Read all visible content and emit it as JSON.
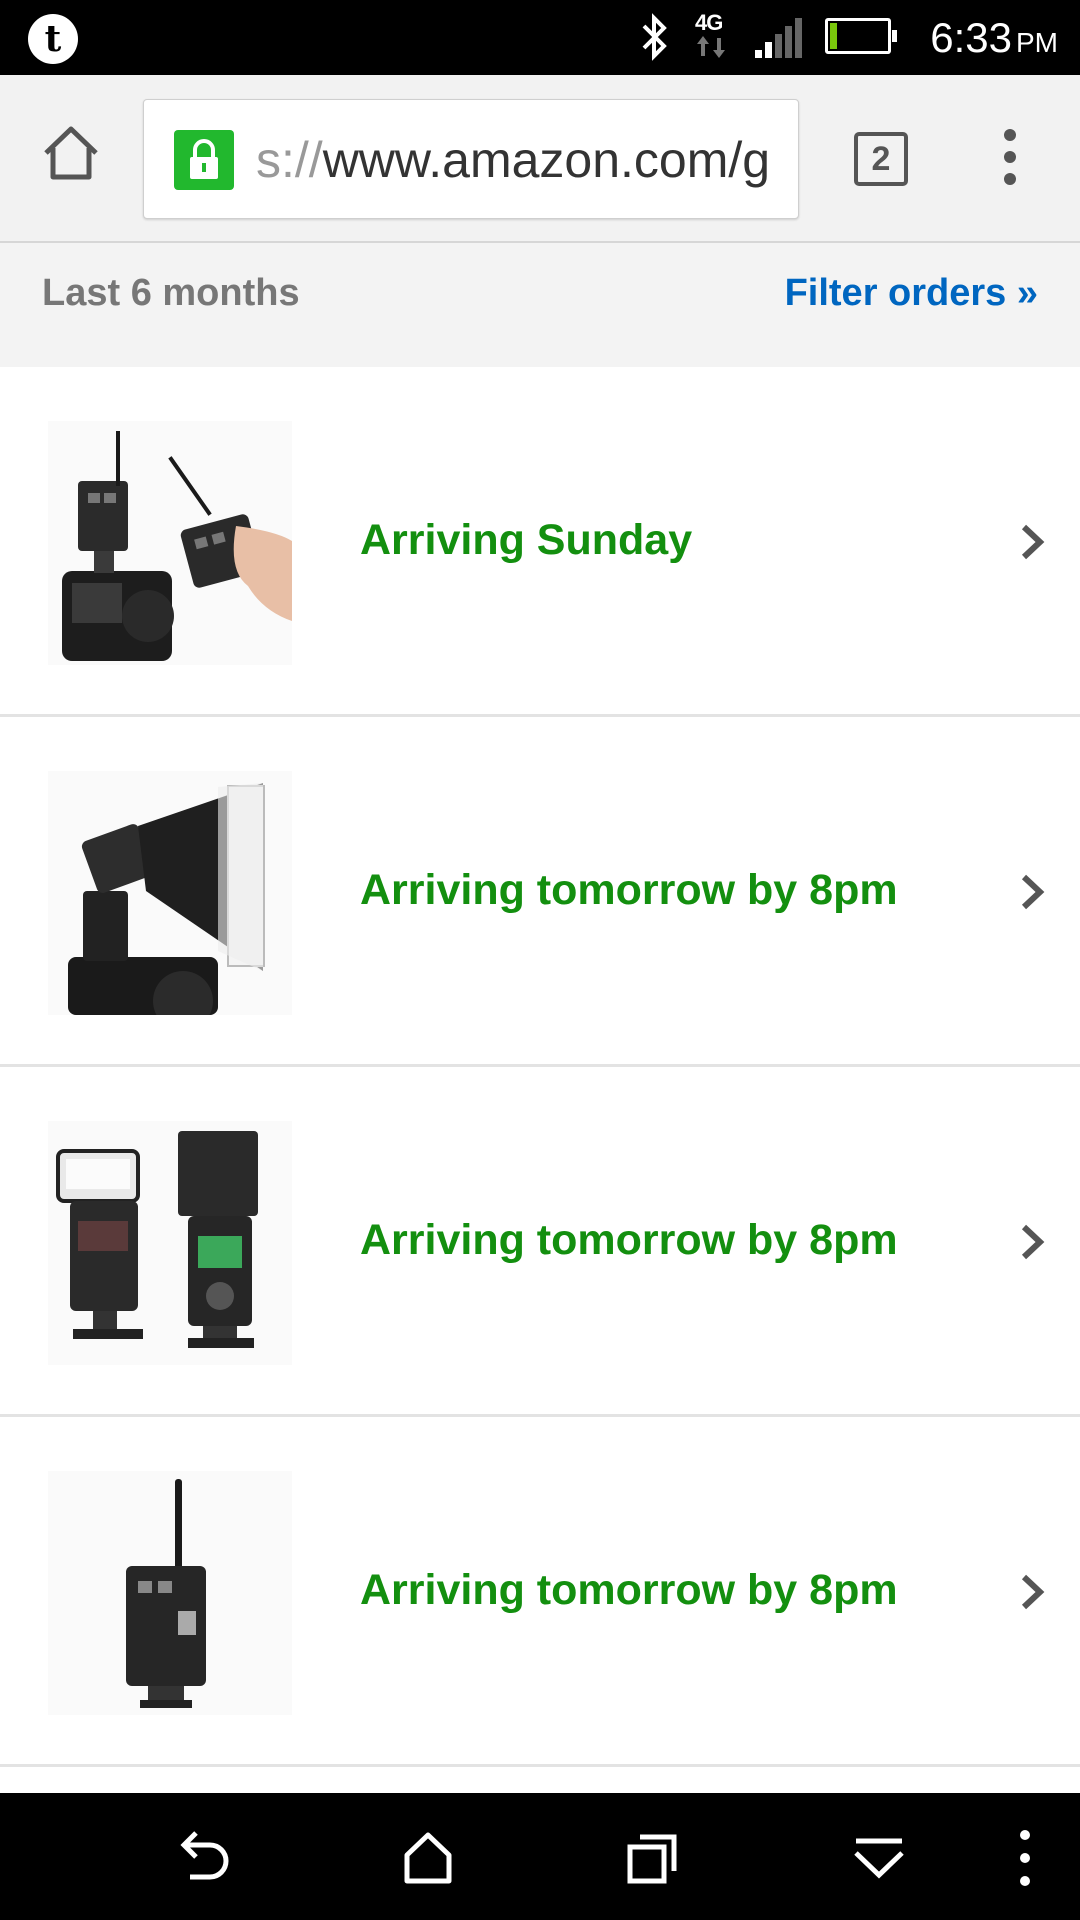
{
  "status_bar": {
    "network": "4G",
    "battery_level": "12",
    "battery_fill_fraction": 0.12,
    "time": "6:33",
    "ampm": "PM"
  },
  "browser": {
    "url_scheme": "s://",
    "url_host": "www.amazon.com/g",
    "tab_count": "2"
  },
  "filter": {
    "period": "Last 6 months",
    "filter_link": "Filter orders »"
  },
  "orders": [
    {
      "status": "Arriving Sunday",
      "thumb_icon": "wireless-flash-trigger-image"
    },
    {
      "status": "Arriving tomorrow by 8pm",
      "thumb_icon": "flash-softbox-image"
    },
    {
      "status": "Arriving tomorrow by 8pm",
      "thumb_icon": "speedlite-flash-image"
    },
    {
      "status": "Arriving tomorrow by 8pm",
      "thumb_icon": "flash-receiver-image"
    }
  ],
  "colors": {
    "status_green": "#138f0f",
    "link_blue": "#0066c0",
    "lock_green": "#22b82e"
  }
}
